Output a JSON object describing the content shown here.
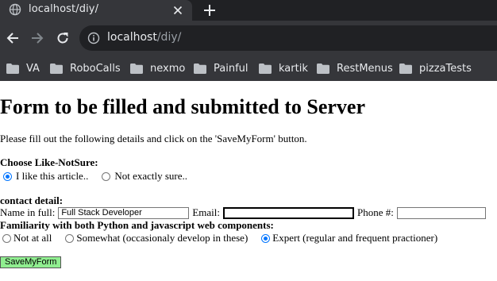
{
  "browser": {
    "tab_title": "localhost/diy/",
    "url_host": "localhost",
    "url_path": "/diy/",
    "bookmarks": [
      "VA",
      "RoboCalls",
      "nexmo",
      "Painful",
      "kartik",
      "RestMenus",
      "pizzaTests"
    ]
  },
  "page": {
    "heading": "Form to be filled and submitted to Server",
    "intro": "Please fill out the following details and click on the 'SaveMyForm' button.",
    "like_section": {
      "title": "Choose Like-NotSure:",
      "options": [
        "I like this article..",
        "Not exactly sure.."
      ],
      "selected": "I like this article.."
    },
    "contact_section": {
      "title": "contact detail:",
      "name_label": "Name in full:",
      "name_value": "Full Stack Developer",
      "email_label": "Email:",
      "email_value": "",
      "phone_label": "Phone #:",
      "phone_value": ""
    },
    "familiarity_section": {
      "title": "Familiarity with both Python and javascript web components:",
      "options": [
        "Not at all",
        "Somewhat (occasionaly develop in these)",
        "Expert (regular and frequent practioner)"
      ],
      "selected": "Expert (regular and frequent practioner)"
    },
    "submit_label": "SaveMyForm"
  },
  "colors": {
    "chrome_dark": "#202124",
    "chrome_toolbar": "#35363a",
    "submit_bg": "#90ee90",
    "radio_accent": "#0075ff"
  }
}
